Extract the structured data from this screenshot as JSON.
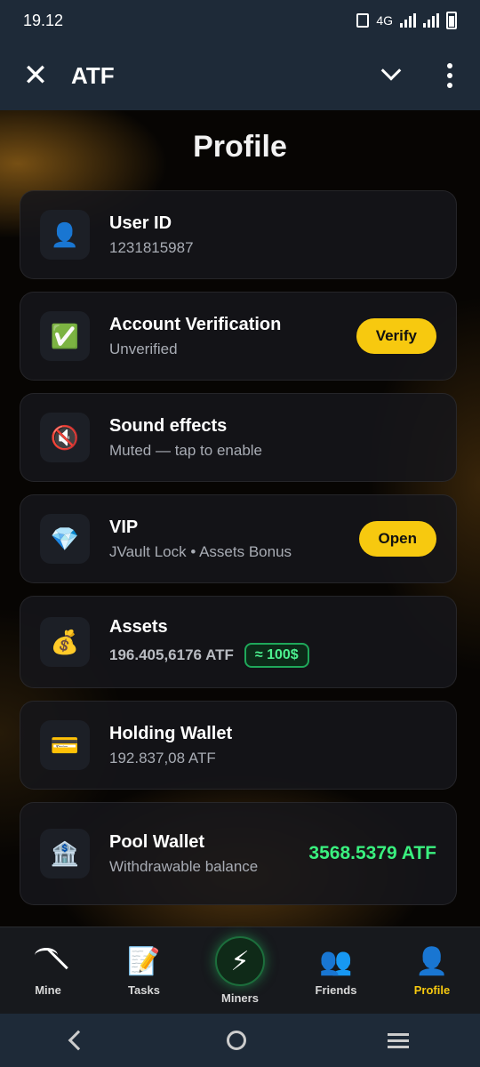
{
  "status": {
    "time": "19.12",
    "network": "4G"
  },
  "header": {
    "title": "ATF"
  },
  "page": {
    "title": "Profile"
  },
  "cards": {
    "user_id": {
      "title": "User ID",
      "value": "1231815987",
      "icon": "person-icon"
    },
    "verification": {
      "title": "Account Verification",
      "value": "Unverified",
      "button": "Verify",
      "icon": "check-icon"
    },
    "sound": {
      "title": "Sound effects",
      "value": "Muted — tap to enable",
      "icon": "muted-speaker-icon"
    },
    "vip": {
      "title": "VIP",
      "value": "JVault Lock • Assets Bonus",
      "button": "Open",
      "icon": "diamond-icon"
    },
    "assets": {
      "title": "Assets",
      "value": "196.405,6176 ATF",
      "usd": "≈ 100$",
      "icon": "money-bag-icon"
    },
    "holding": {
      "title": "Holding Wallet",
      "value": "192.837,08 ATF",
      "icon": "credit-card-icon"
    },
    "pool": {
      "title": "Pool Wallet",
      "value": "Withdrawable balance",
      "amount": "3568.5379 ATF",
      "icon": "bank-icon"
    }
  },
  "nav": {
    "mine": "Mine",
    "tasks": "Tasks",
    "miners": "Miners",
    "friends": "Friends",
    "profile": "Profile",
    "active": "profile"
  },
  "colors": {
    "accent": "#f7c90f",
    "positive": "#3af07f",
    "bar": "#1e2a38"
  }
}
